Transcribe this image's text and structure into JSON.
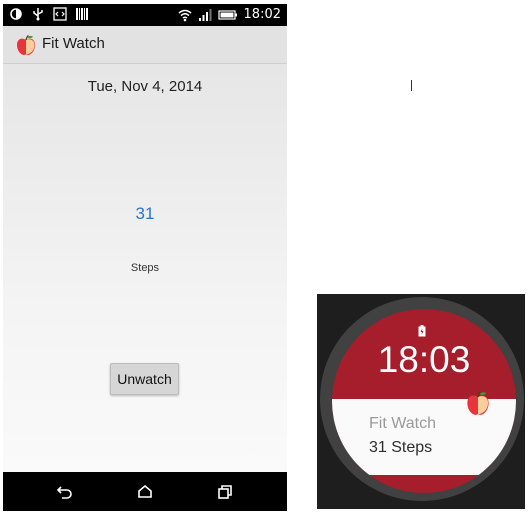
{
  "statusbar": {
    "time": "18:02",
    "icons": [
      "notification-icon",
      "usb-icon",
      "code-icon",
      "barcode-icon",
      "wifi-icon",
      "signal-icon",
      "battery-icon"
    ]
  },
  "app": {
    "title": "Fit Watch",
    "icon": "apple-icon"
  },
  "main": {
    "date": "Tue, Nov 4, 2014",
    "steps_count": "31",
    "steps_label": "Steps",
    "unwatch_label": "Unwatch"
  },
  "navbar": {
    "icons": [
      "back-icon",
      "home-icon",
      "recents-icon"
    ]
  },
  "watch": {
    "time": "18:03",
    "app_name": "Fit Watch",
    "steps_text": "31 Steps",
    "charging_icon": "battery-charging-icon"
  },
  "colors": {
    "steps_blue": "#2a74c7",
    "watch_red": "#a61d2b",
    "apple_red": "#e8343b"
  }
}
